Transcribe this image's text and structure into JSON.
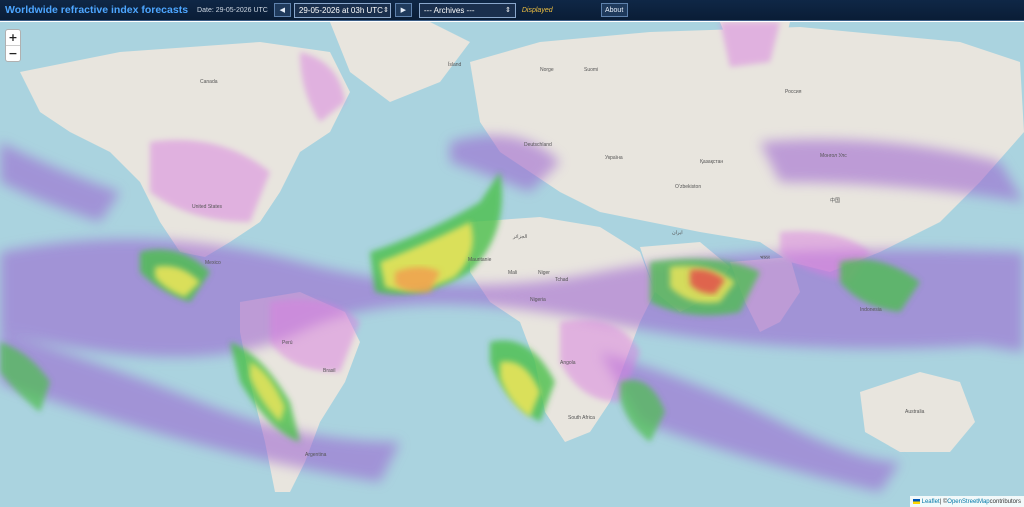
{
  "header": {
    "title": "Worldwide refractive index forecasts",
    "date_label": "Date: 29-05-2026 UTC",
    "prev_icon": "◀",
    "next_icon": "▶",
    "forecast_select": "29-05-2026 at 03h UTC",
    "archives_select": "--- Archives ---",
    "displayed_label": "Displayed",
    "about_label": "About"
  },
  "map": {
    "zoom_in": "+",
    "zoom_out": "−",
    "labels": {
      "canada": "Canada",
      "united_states": "United States",
      "mexico": "Mexico",
      "brazil": "Brasil",
      "argentina": "Argentina",
      "peru": "Perú",
      "russia": "Россия",
      "kazakhstan": "Қазақстан",
      "mongolia": "Монгол Улс",
      "china": "中国",
      "india": "भारत",
      "mali": "Mali",
      "niger": "Niger",
      "nigeria": "Nigeria",
      "tchad": "Tchad",
      "algeria": "الجزائر",
      "south_africa": "South Africa",
      "angola": "Angola",
      "australia": "Australia",
      "indonesia": "Indonesia",
      "norge": "Norge",
      "suomi": "Suomi",
      "island": "Ísland",
      "ukraine": "Україна",
      "uzbekistan": "Oʻzbekiston",
      "deutschland": "Deutschland",
      "iran": "ایران",
      "mauritanie": "Mauritanie"
    },
    "attribution": {
      "leaflet": "Leaflet",
      "separator": " | © ",
      "osm": "OpenStreetMap",
      "suffix": " contributors"
    }
  },
  "colors": {
    "ocean": "#aad3df",
    "land": "#e8e5de",
    "purple": "#9a5fd0",
    "magenta": "#d97fe0",
    "green": "#4bbf4b",
    "yellow": "#e8e35a",
    "orange": "#f0a050",
    "red": "#e0504a"
  }
}
